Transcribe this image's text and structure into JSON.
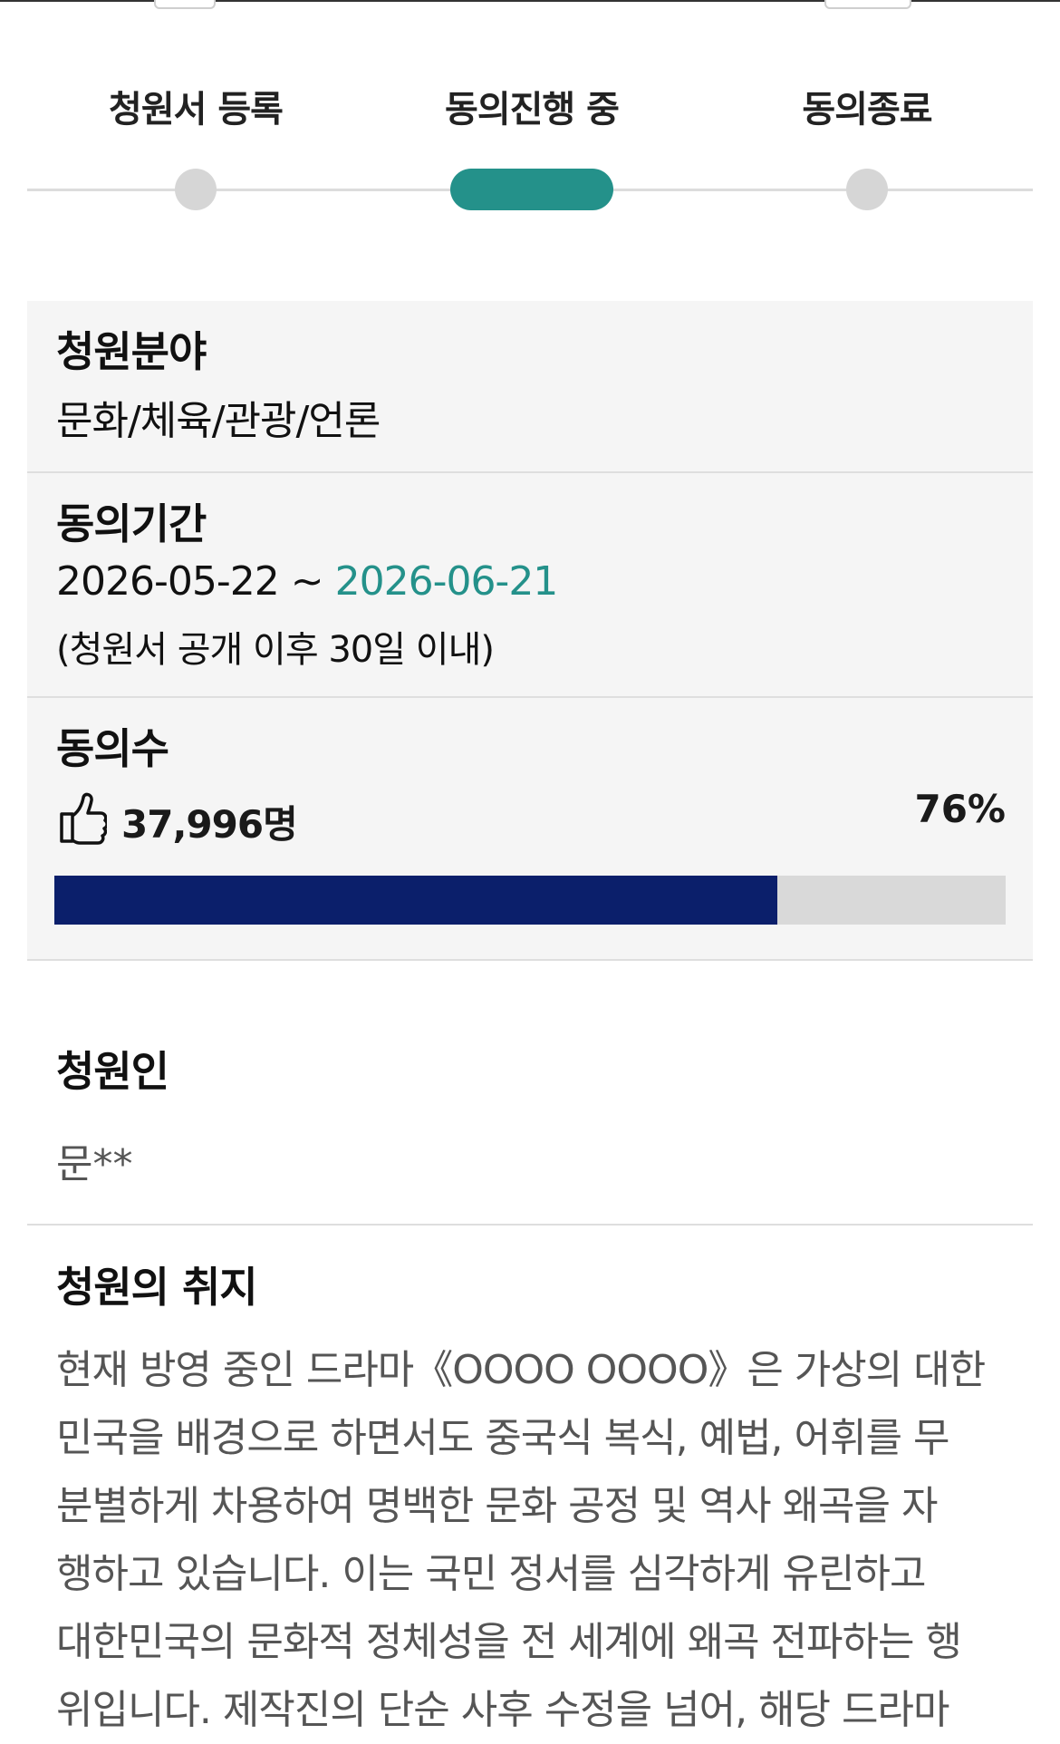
{
  "steps": [
    {
      "label": "청원서 등록",
      "active": false
    },
    {
      "label": "동의진행 중",
      "active": true
    },
    {
      "label": "동의종료",
      "active": false
    }
  ],
  "field": {
    "title": "청원분야",
    "value": "문화/체육/관광/언론"
  },
  "period": {
    "title": "동의기간",
    "start": "2026-05-22",
    "separator": "~",
    "end": "2026-06-21",
    "note": "(청원서 공개 이후 30일 이내)"
  },
  "agree": {
    "title": "동의수",
    "icon": "thumbs-up-icon",
    "count": "37,996명",
    "percent_label": "76%",
    "progress": 0.76,
    "colors": {
      "fill": "#0b1f6b",
      "track": "#d9d9d9"
    }
  },
  "petitioner": {
    "title": "청원인",
    "name": "문**"
  },
  "purpose": {
    "title": "청원의 취지",
    "lines": [
      "현재 방영 중인 드라마《OOOO OOOO》은 가상의 대한",
      "민국을 배경으로 하면서도 중국식 복식, 예법, 어휘를 무",
      "분별하게 차용하여 명백한 문화 공정 및 역사 왜곡을 자",
      "행하고 있습니다. 이는 국민 정서를 심각하게 유린하고",
      "대한민국의 문화적 정체성을 전 세계에 왜곡 전파하는 행",
      "위입니다. 제작진의 단순 사후 수정을 넘어, 해당 드라마"
    ]
  },
  "colors": {
    "accent": "#24918a",
    "panel_bg": "#f5f5f5"
  }
}
